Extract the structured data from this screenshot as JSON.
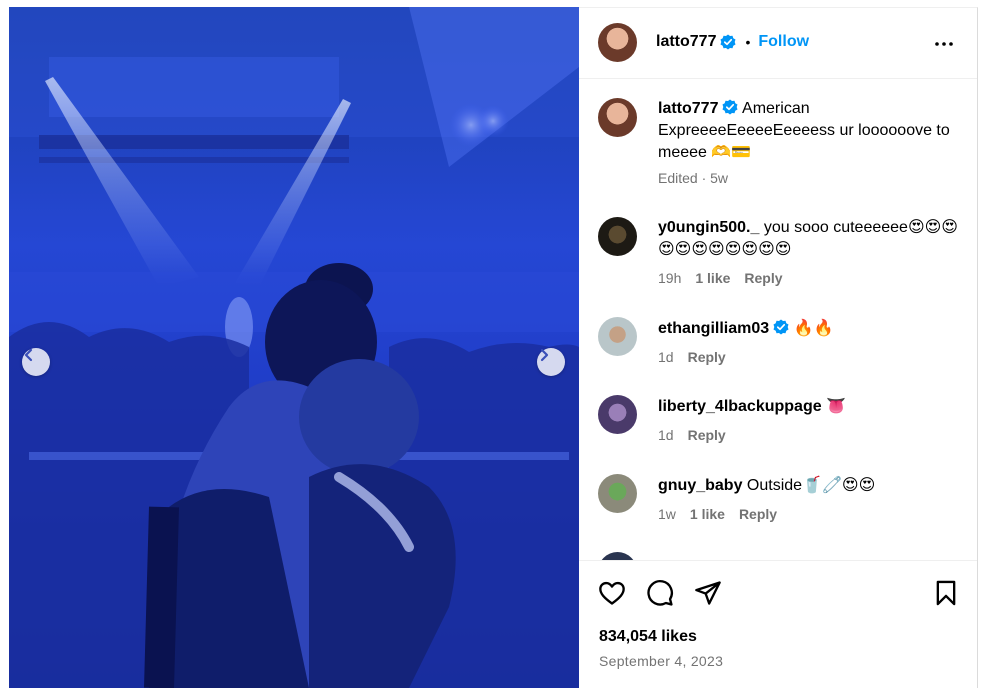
{
  "post": {
    "author": "latto777",
    "follow_label": "Follow",
    "separator": "•",
    "caption": "American ExpreeeeEeeeeEeeeess ur loooooove to meeee 🫶💳",
    "caption_meta": "Edited · 5w",
    "likes": "834,054 likes",
    "date": "September 4, 2023"
  },
  "comments": [
    {
      "user": "y0ungin500._",
      "text": "you sooo cuteeeeee😍😍😍😍😍😍😍😍😍😍😍",
      "age": "19h",
      "likes": "1 like",
      "reply": "Reply",
      "verified": false
    },
    {
      "user": "ethangilliam03",
      "text": "🔥🔥",
      "age": "1d",
      "likes": "",
      "reply": "Reply",
      "verified": true
    },
    {
      "user": "liberty_4lbackuppage",
      "text": "👅",
      "age": "1d",
      "likes": "",
      "reply": "Reply",
      "verified": false
    },
    {
      "user": "gnuy_baby",
      "text": "Outside🥤🧷😍😍",
      "age": "1w",
      "likes": "1 like",
      "reply": "Reply",
      "verified": false
    }
  ],
  "icons": [
    "chevron-left-icon",
    "chevron-right-icon",
    "verified-badge-icon",
    "more-options-icon",
    "heart-icon",
    "comment-icon",
    "share-icon",
    "bookmark-icon"
  ],
  "colors": {
    "link_blue": "#0095f6",
    "photo_blue": "#2547d4",
    "secondary_text": "#737373"
  }
}
